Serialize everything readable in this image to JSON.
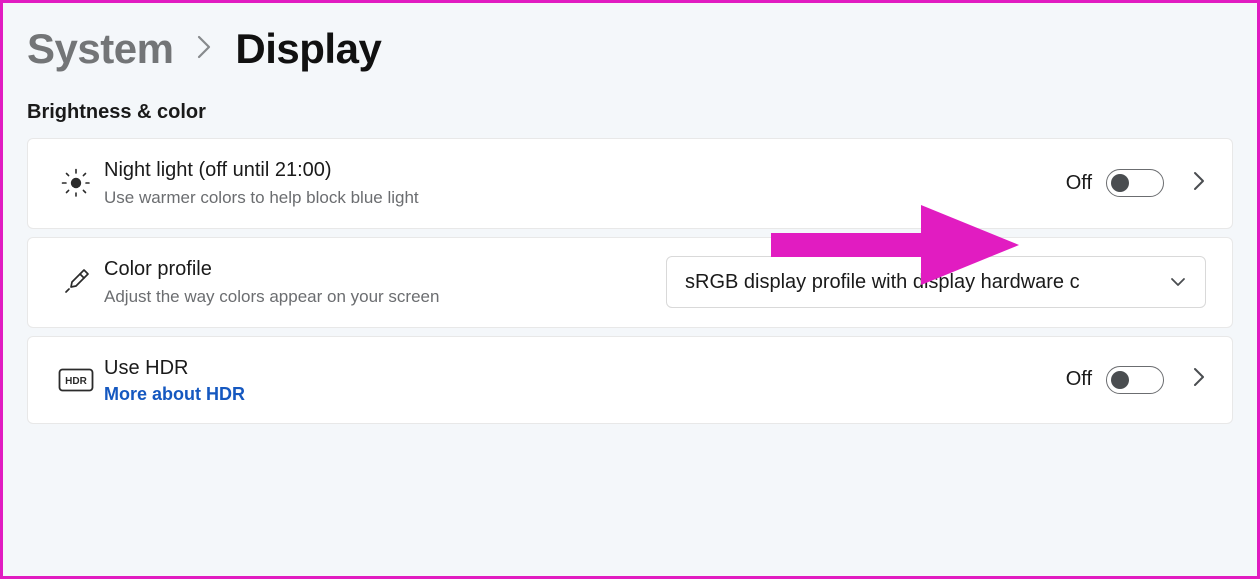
{
  "breadcrumb": {
    "parent": "System",
    "current": "Display"
  },
  "section": {
    "heading": "Brightness & color"
  },
  "nightLight": {
    "title": "Night light (off until 21:00)",
    "desc": "Use warmer colors to help block blue light",
    "stateLabel": "Off"
  },
  "colorProfile": {
    "title": "Color profile",
    "desc": "Adjust the way colors appear on your screen",
    "selected": "sRGB display profile with display hardware c"
  },
  "hdr": {
    "title": "Use HDR",
    "link": "More about HDR",
    "stateLabel": "Off"
  },
  "annotation": {
    "color": "#e11cc1"
  }
}
